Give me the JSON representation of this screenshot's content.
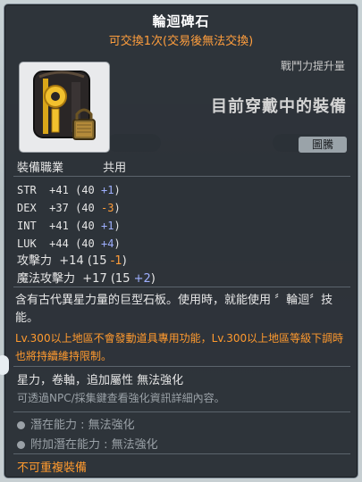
{
  "item": {
    "name": "輪迴碑石",
    "trade_note": "可交換1次(交易後無法交換)",
    "combat_label": "戰鬥力提升量",
    "equip_status": "目前穿戴中的裝備",
    "badge": "圖騰",
    "job_label": "裝備職業",
    "job_value": "共用"
  },
  "stats": [
    {
      "name": "STR",
      "value": "+41",
      "base": "(40",
      "delta": "+1",
      "close": ")",
      "type": "plus"
    },
    {
      "name": "DEX",
      "value": "+37",
      "base": "(40",
      "delta": "-3",
      "close": ")",
      "type": "minus"
    },
    {
      "name": "INT",
      "value": "+41",
      "base": "(40",
      "delta": "+1",
      "close": ")",
      "type": "plus"
    },
    {
      "name": "LUK",
      "value": "+44",
      "base": "(40",
      "delta": "+4",
      "close": ")",
      "type": "plus"
    }
  ],
  "attack": [
    {
      "name": "攻擊力",
      "value": "+14",
      "base": "(15",
      "delta": "-1",
      "close": ")",
      "type": "minus"
    },
    {
      "name": "魔法攻擊力",
      "value": "+17",
      "base": "(15",
      "delta": "+2",
      "close": ")",
      "type": "plus"
    }
  ],
  "description": "含有古代異星力量的巨型石板。使用時，就能使用 〞輪迴〞技能。",
  "notice": "Lv.300以上地區不會發動道具專用功能，Lv.300以上地區等級下調時也將持續維持限制。",
  "enhance_text": "星力，卷軸，追加屬性 無法強化",
  "enhance_hint": "可透過NPC/採集鍵查看強化資訊詳細內容。",
  "potential": "潛在能力 : 無法強化",
  "additional_potential": "附加潛在能力 : 無法強化",
  "no_duplicate": "不可重複裝備",
  "colors": {
    "panel_bg": "#22282e",
    "orange": "#ff9a2e",
    "stat_plus": "#9fb0ff",
    "stat_minus": "#ff9d3a"
  },
  "icon": "totem-stone-icon"
}
